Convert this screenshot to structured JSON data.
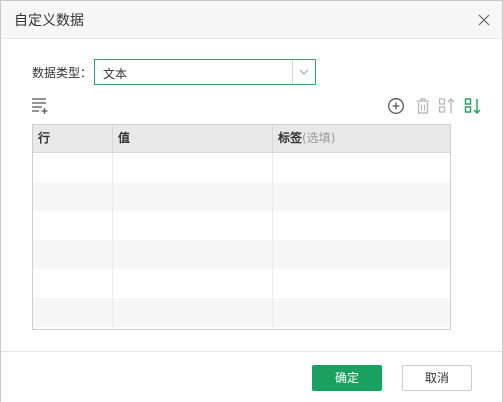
{
  "dialog": {
    "title": "自定义数据"
  },
  "form": {
    "type_label": "数据类型：",
    "type_value": "文本"
  },
  "toolbar": {
    "icons": [
      "batch-add-icon",
      "add-circle-icon",
      "delete-icon",
      "sort-ascending-icon",
      "sort-descending-icon"
    ],
    "active_color": "#1aa15f",
    "inactive_color": "#b5b5b5"
  },
  "table": {
    "columns": [
      {
        "label": "行",
        "hint": ""
      },
      {
        "label": "值",
        "hint": ""
      },
      {
        "label": "标签",
        "hint": "(选填)"
      }
    ],
    "rows": [
      [
        "",
        "",
        ""
      ],
      [
        "",
        "",
        ""
      ],
      [
        "",
        "",
        ""
      ],
      [
        "",
        "",
        ""
      ],
      [
        "",
        "",
        ""
      ],
      [
        "",
        "",
        ""
      ]
    ]
  },
  "footer": {
    "ok_label": "确定",
    "cancel_label": "取消"
  },
  "colors": {
    "accent": "#1aa15f",
    "select_border": "#2aa86c"
  }
}
